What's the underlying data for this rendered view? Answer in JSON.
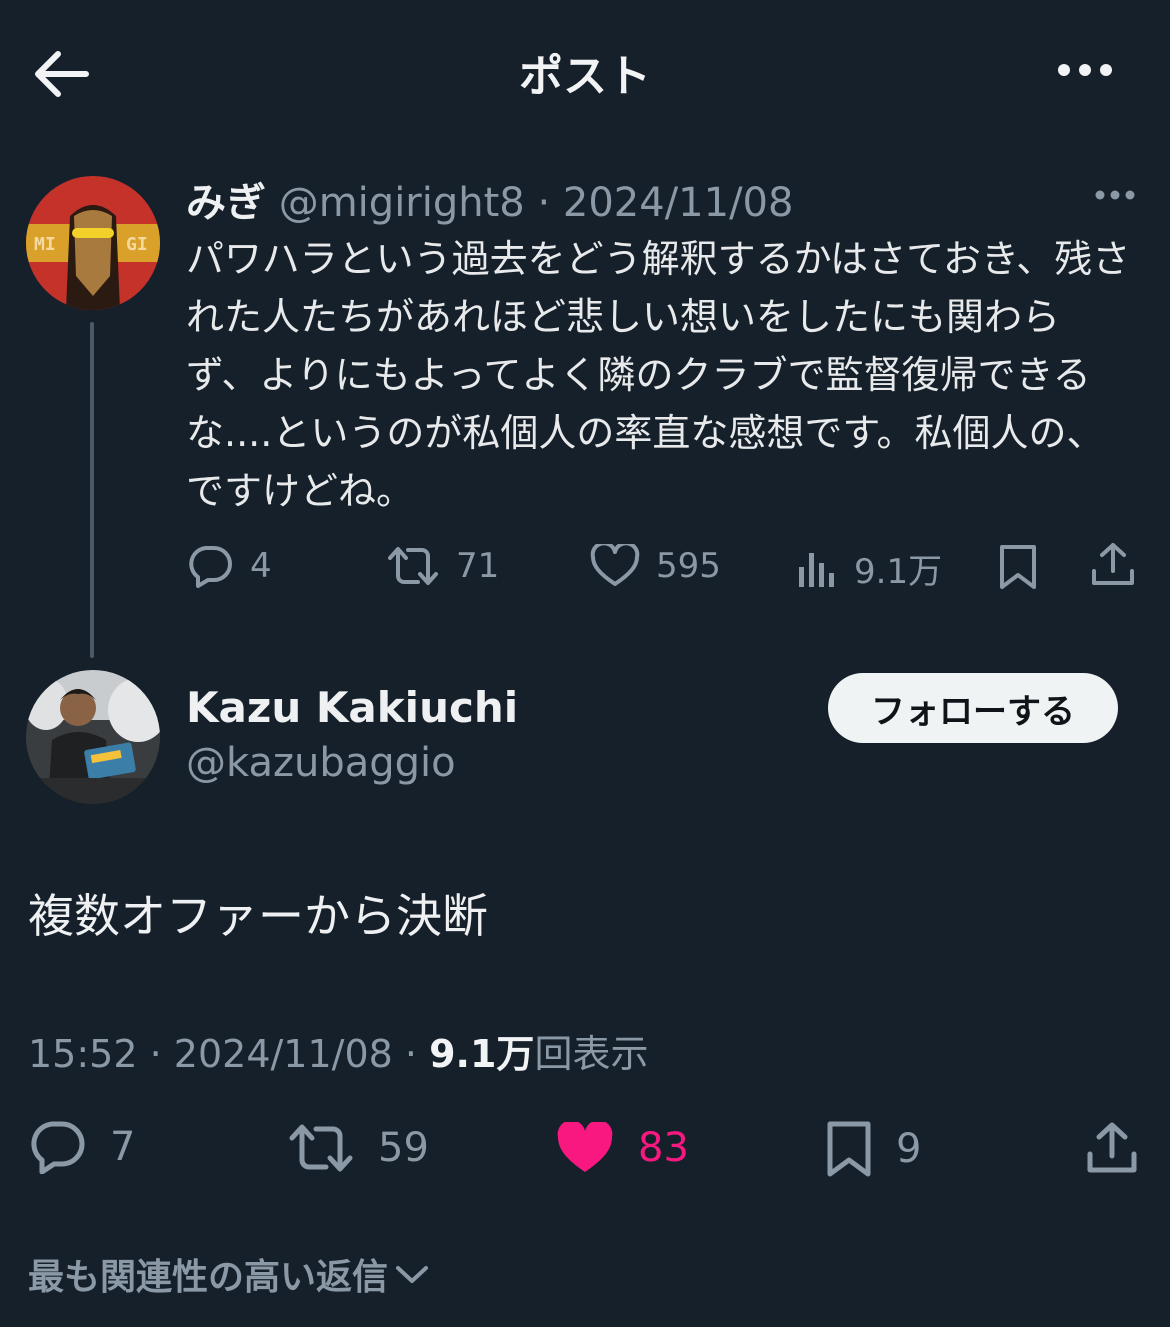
{
  "header": {
    "title": "ポスト"
  },
  "quoted": {
    "name": "みぎ",
    "handle": "@migiright8",
    "date": "2024/11/08",
    "avatar_text_left": "MI",
    "avatar_text_right": "GI",
    "text": "パワハラという過去をどう解釈するかはさておき、残された人たちがあれほど悲しい想いをしたにも関わらず、よりにもよってよく隣のクラブで監督復帰できるな....というのが私個人の率直な感想です。私個人の、ですけどね。",
    "actions": {
      "replies": "4",
      "reposts": "71",
      "likes": "595",
      "views": "9.1万"
    }
  },
  "post": {
    "name": "Kazu Kakiuchi",
    "handle": "@kazubaggio",
    "follow_label": "フォローする",
    "text": "複数オファーから決断",
    "time": "15:52",
    "date": "2024/11/08",
    "views": "9.1万",
    "views_suffix": "回表示",
    "actions": {
      "replies": "7",
      "reposts": "59",
      "likes": "83",
      "bookmarks": "9"
    }
  },
  "replies_sort": {
    "label": "最も関連性の高い返信"
  },
  "colors": {
    "background": "#15202b",
    "like": "#f91880",
    "secondary": "#8b98a5"
  }
}
